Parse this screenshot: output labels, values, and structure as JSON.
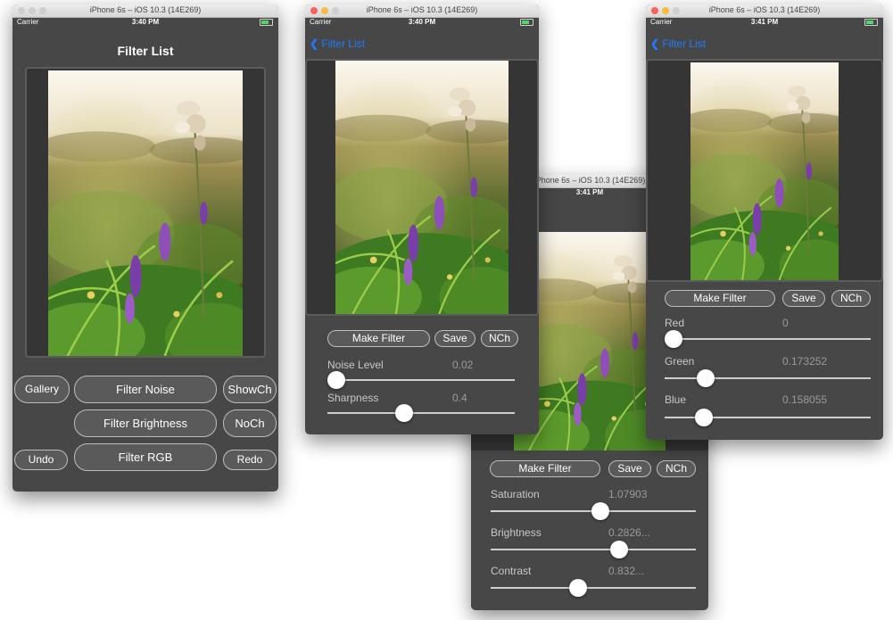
{
  "window1": {
    "title": "iPhone 6s – iOS 10.3 (14E269)",
    "carrier": "Carrier",
    "time": "3:40 PM",
    "nav_title": "Filter List",
    "buttons": {
      "gallery": "Gallery",
      "filter_noise": "Filter Noise",
      "show_ch": "ShowCh",
      "filter_brightness": "Filter Brightness",
      "no_ch": "NoCh",
      "undo": "Undo",
      "filter_rgb": "Filter RGB",
      "redo": "Redo"
    }
  },
  "window2": {
    "title": "iPhone 6s – iOS 10.3 (14E269)",
    "carrier": "Carrier",
    "time": "3:40 PM",
    "back_label": "Filter List",
    "make_filter": "Make Filter",
    "save": "Save",
    "nch": "NCh",
    "sliders": [
      {
        "label": "Noise Level",
        "value_text": "0.02",
        "fraction": 0.0
      },
      {
        "label": "Sharpness",
        "value_text": "0.4",
        "fraction": 0.4
      }
    ]
  },
  "window3": {
    "title": "iPhone 6s – iOS 10.3 (14E269)",
    "time": "3:41 PM",
    "make_filter": "Make Filter",
    "save": "Save",
    "nch": "NCh",
    "sliders": [
      {
        "label": "Saturation",
        "value_text": "1.07903",
        "fraction": 0.54
      },
      {
        "label": "Brightness",
        "value_text": "0.2826...",
        "fraction": 0.64
      },
      {
        "label": "Contrast",
        "value_text": "0.832...",
        "fraction": 0.42
      }
    ]
  },
  "window4": {
    "title": "iPhone 6s – iOS 10.3 (14E269)",
    "carrier": "Carrier",
    "time": "3:41 PM",
    "back_label": "Filter List",
    "make_filter": "Make Filter",
    "save": "Save",
    "nch": "NCh",
    "sliders": [
      {
        "label": "Red",
        "value_text": "0",
        "fraction": 0.0
      },
      {
        "label": "Green",
        "value_text": "0.173252",
        "fraction": 0.17
      },
      {
        "label": "Blue",
        "value_text": "0.158055",
        "fraction": 0.16
      }
    ]
  },
  "colors": {
    "window_bg": "#474747",
    "accent": "#1e7bfd",
    "button_bg": "#5a5a5a"
  }
}
